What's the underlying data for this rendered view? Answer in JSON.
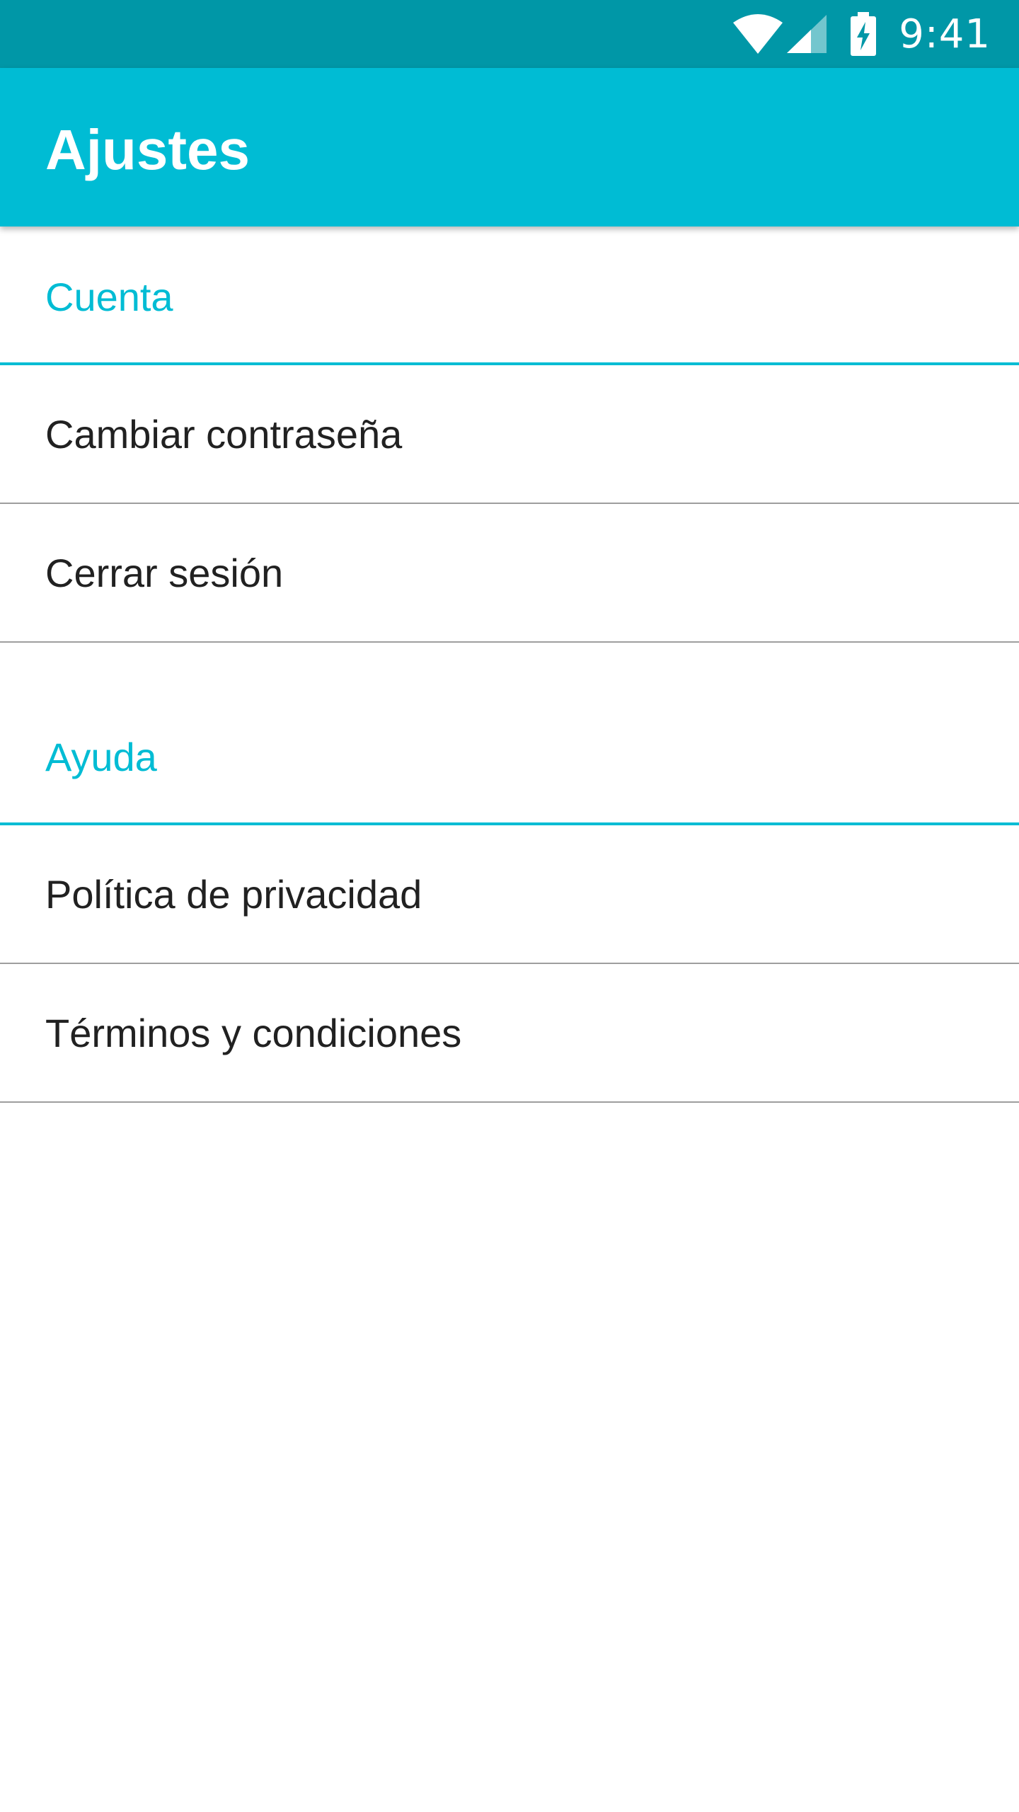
{
  "status_bar": {
    "time": "9:41",
    "icons": [
      "wifi-icon",
      "signal-icon",
      "battery-charging-icon"
    ]
  },
  "app_bar": {
    "title": "Ajustes"
  },
  "sections": [
    {
      "title": "Cuenta",
      "items": [
        {
          "label": "Cambiar contraseña"
        },
        {
          "label": "Cerrar sesión"
        }
      ]
    },
    {
      "title": "Ayuda",
      "items": [
        {
          "label": "Política de privacidad"
        },
        {
          "label": "Términos y condiciones"
        }
      ]
    }
  ],
  "colors": {
    "status_bar": "#0097a7",
    "app_bar": "#00bcd4",
    "accent": "#00bcd4",
    "divider": "#9e9e9e",
    "text": "#212121"
  }
}
